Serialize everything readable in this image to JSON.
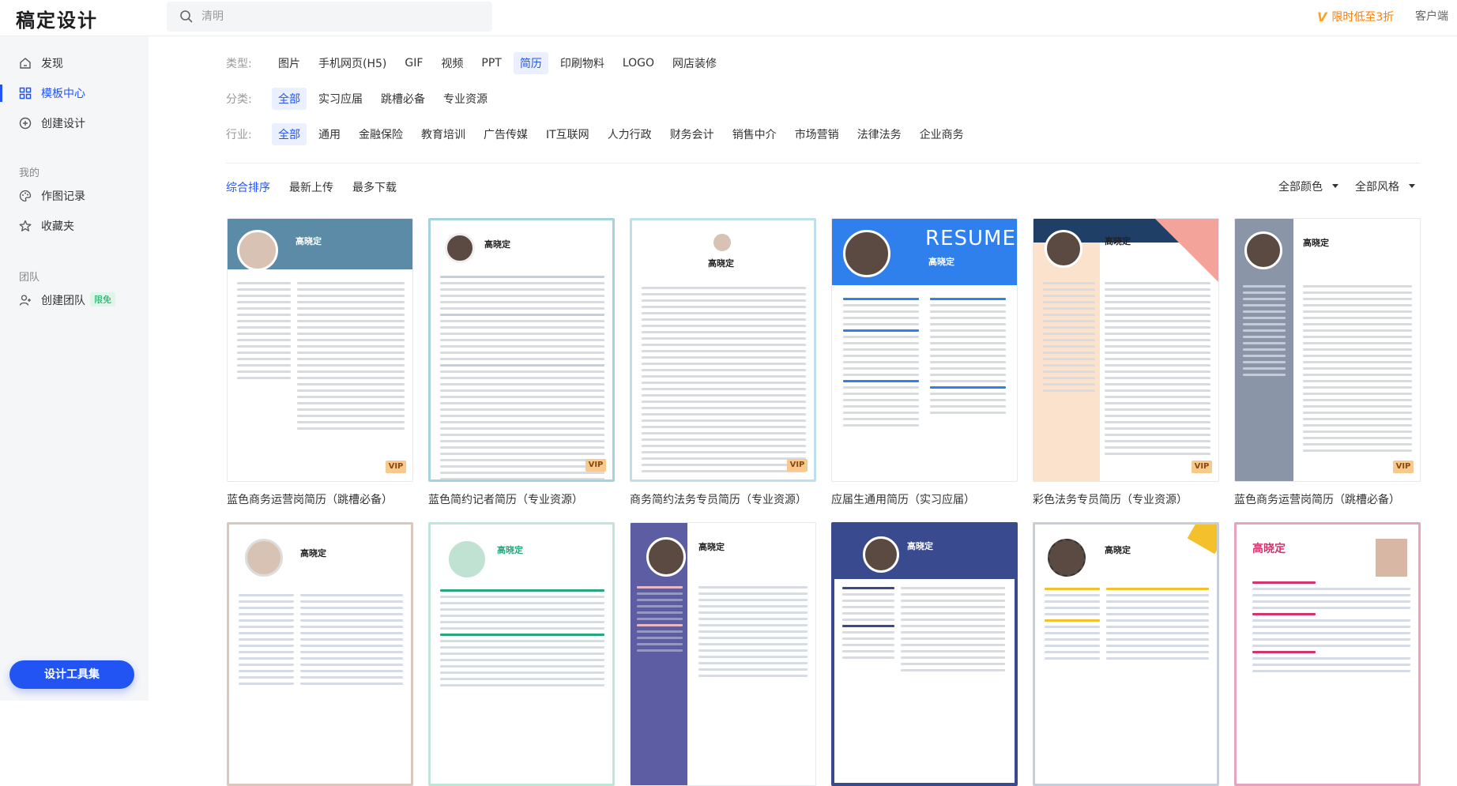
{
  "header": {
    "logo": "稿定设计",
    "search_placeholder": "清明",
    "promo": "限时低至3折",
    "promo_mark": "V",
    "client": "客户端"
  },
  "sidebar": {
    "items": [
      {
        "label": "发现"
      },
      {
        "label": "模板中心"
      },
      {
        "label": "创建设计"
      }
    ],
    "mine_label": "我的",
    "mine_items": [
      {
        "label": "作图记录"
      },
      {
        "label": "收藏夹"
      }
    ],
    "team_label": "团队",
    "team_item": "创建团队",
    "team_badge": "限免",
    "tool_button": "设计工具集"
  },
  "filters": {
    "type_label": "类型:",
    "types": [
      "图片",
      "手机网页(H5)",
      "GIF",
      "视频",
      "PPT",
      "简历",
      "印刷物料",
      "LOGO",
      "网店装修"
    ],
    "category_label": "分类:",
    "categories": [
      "全部",
      "实习应届",
      "跳槽必备",
      "专业资源"
    ],
    "industry_label": "行业:",
    "industries": [
      "全部",
      "通用",
      "金融保险",
      "教育培训",
      "广告传媒",
      "IT互联网",
      "人力行政",
      "财务会计",
      "销售中介",
      "市场营销",
      "法律法务",
      "企业商务"
    ]
  },
  "sort": {
    "options": [
      "综合排序",
      "最新上传",
      "最多下载"
    ],
    "color_filter": "全部颜色",
    "style_filter": "全部风格"
  },
  "cards": [
    {
      "title": "蓝色商务运营岗简历（跳槽必备）",
      "vip": "VIP",
      "name": "高晓定",
      "accent": "#5b8ba6"
    },
    {
      "title": "蓝色简约记者简历（专业资源）",
      "vip": "VIP",
      "name": "高晓定",
      "accent": "#a6d2de"
    },
    {
      "title": "商务简约法务专员简历（专业资源）",
      "vip": "VIP",
      "name": "高晓定",
      "accent": "#8ab8cf"
    },
    {
      "title": "应届生通用简历（实习应届）",
      "vip": "",
      "name": "高晓定",
      "accent": "#2f80ed",
      "banner": "RESUME"
    },
    {
      "title": "彩色法务专员简历（专业资源）",
      "vip": "VIP",
      "name": "高晓定",
      "accent": "#f7c9a7"
    },
    {
      "title": "蓝色商务运营岗简历（跳槽必备）",
      "vip": "VIP",
      "name": "高晓定",
      "accent": "#8a96a8"
    },
    {
      "title": "",
      "vip": "",
      "name": "高晓定",
      "accent": "#b89b8b"
    },
    {
      "title": "",
      "vip": "",
      "name": "高晓定",
      "accent": "#2ba57a"
    },
    {
      "title": "",
      "vip": "",
      "name": "高晓定",
      "accent": "#5d5da3"
    },
    {
      "title": "",
      "vip": "",
      "name": "高晓定",
      "accent": "#3a4a8f"
    },
    {
      "title": "",
      "vip": "",
      "name": "高晓定",
      "accent": "#f3c12b"
    },
    {
      "title": "",
      "vip": "",
      "name": "高晓定",
      "accent": "#d6336c"
    }
  ],
  "colors": {
    "primary": "#2254f4",
    "promo": "#ff7d00"
  }
}
